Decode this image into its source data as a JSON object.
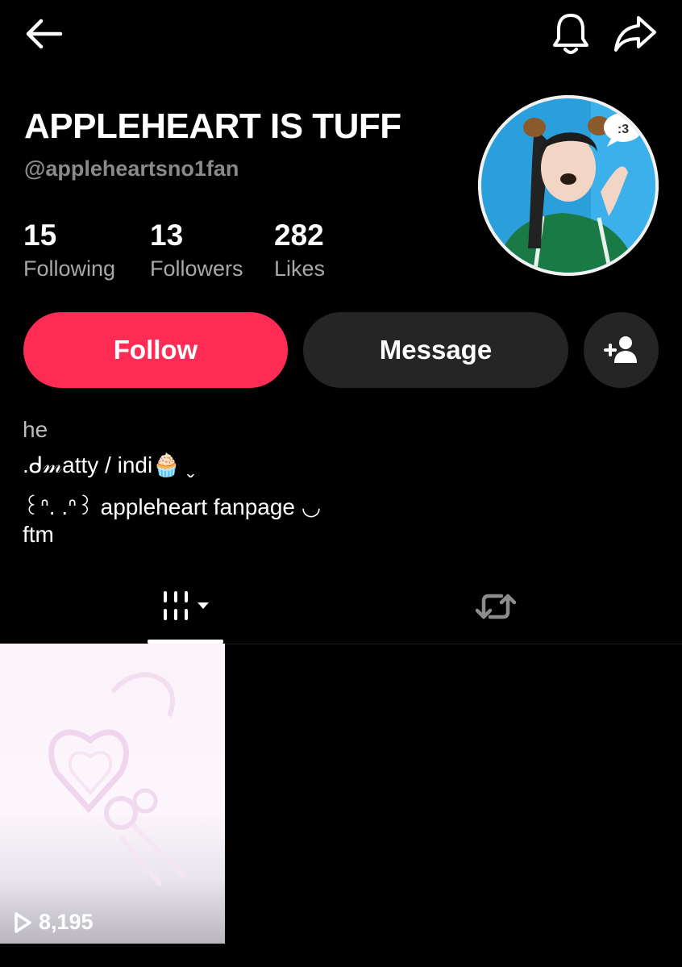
{
  "header": {
    "back_icon": "arrow-left-icon",
    "bell_icon": "bell-icon",
    "share_icon": "share-icon"
  },
  "profile": {
    "display_name": "APPLEHEART IS TUFF",
    "username": "@appleheartsno1fan",
    "stats": [
      {
        "value": "15",
        "label": "Following"
      },
      {
        "value": "13",
        "label": "Followers"
      },
      {
        "value": "282",
        "label": "Likes"
      }
    ],
    "bio_lines": [
      "he",
      ".ᑯ𝓂atty / indi🧁 ˬ",
      "꒰ᐢ. .ᐢ꒱ appleheart fanpage ◡",
      "ftm"
    ]
  },
  "actions": {
    "follow_label": "Follow",
    "message_label": "Message",
    "add_friend_icon": "add-user-icon"
  },
  "tabs": [
    {
      "name": "videos",
      "icon": "grid-icon",
      "active": true
    },
    {
      "name": "reposts",
      "icon": "repost-icon",
      "active": false
    }
  ],
  "videos": [
    {
      "views": "8,195"
    }
  ],
  "avatar": {
    "bubble_text": ":3"
  },
  "colors": {
    "accent": "#fe2c55",
    "secondary_button": "#252525",
    "background": "#000000"
  }
}
